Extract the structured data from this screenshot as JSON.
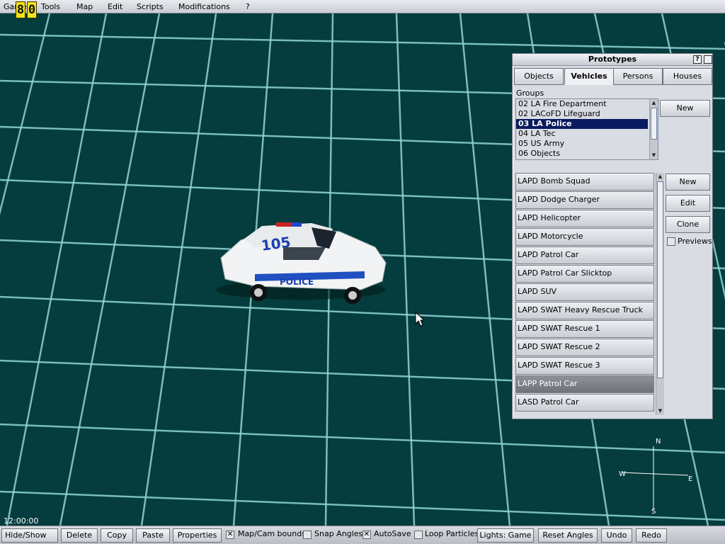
{
  "menu": {
    "items": [
      {
        "text": "Game",
        "accel": ""
      },
      {
        "text": "Tools",
        "accel": "T"
      },
      {
        "text": "Map",
        "accel": "M"
      },
      {
        "text": "Edit",
        "accel": "E"
      },
      {
        "text": "Scripts",
        "accel": "S"
      },
      {
        "text": "Modifications",
        "accel": "M"
      },
      {
        "text": "?",
        "accel": "?"
      }
    ],
    "fps_digits": [
      "8",
      "0"
    ]
  },
  "prototypes": {
    "title": "Prototypes",
    "help_btn": "?",
    "tabs": [
      "Objects",
      "Vehicles",
      "Persons",
      "Houses"
    ],
    "active_tab": "Vehicles",
    "groups_label": "Groups",
    "groups": [
      "02 LA Fire Department",
      "02 LACoFD Lifeguard",
      "03 LA Police",
      "04 LA Tec",
      "05 US Army",
      "06 Objects"
    ],
    "selected_group": "03 LA Police",
    "group_new_btn": "New",
    "items": [
      "LAPD Bomb Squad",
      "LAPD Dodge Charger",
      "LAPD Helicopter",
      "LAPD Motorcycle",
      "LAPD Patrol Car",
      "LAPD Patrol Car Slicktop",
      "LAPD SUV",
      "LAPD SWAT Heavy Rescue Truck",
      "LAPD SWAT Rescue 1",
      "LAPD SWAT Rescue 2",
      "LAPD SWAT Rescue 3",
      "LAPP Patrol Car",
      "LASD Patrol Car"
    ],
    "highlighted_item": "LAPP Patrol Car",
    "buttons": {
      "new": "New",
      "edit": "Edit",
      "clone": "Clone"
    },
    "previews_label": "Previews"
  },
  "viewport": {
    "car_number": "105",
    "car_text": "POLICE",
    "clock": "12:00:00",
    "compass": {
      "n": "N",
      "s": "S",
      "e": "E",
      "w": "W"
    }
  },
  "toolbar": {
    "hide_show": "Hide/Show",
    "delete": "Delete",
    "copy": "Copy",
    "paste": "Paste",
    "properties": "Properties",
    "map_cam_bounds": "Map/Cam bounds",
    "snap_angles": "Snap Angles",
    "autosave": "AutoSave",
    "loop_particles": "Loop Particles",
    "lights_game": "Lights: Game",
    "reset_angles": "Reset Angles",
    "undo": "Undo",
    "redo": "Redo"
  },
  "checkbox_states": {
    "map_cam_bounds": true,
    "snap_angles": false,
    "autosave": true,
    "loop_particles": false,
    "previews": false
  }
}
